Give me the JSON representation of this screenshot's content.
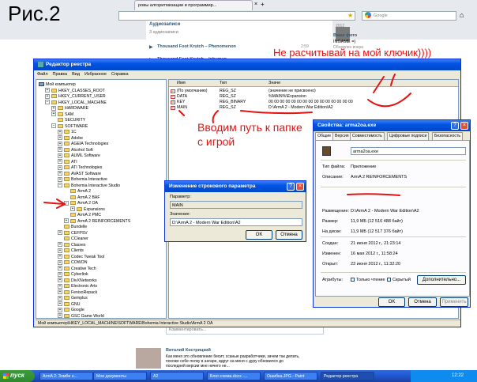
{
  "figure_label": "Рис.2",
  "browser": {
    "tabs": [
      "ровы алгоритмизации и программир..."
    ],
    "search_placeholder": "Google",
    "vk_title": "Аудиозаписи",
    "vk_subtitle": "3 аудиозаписи",
    "tracks": [
      {
        "title": "Thousand Foot Krutch – Phenomenon",
        "time": "2:59"
      },
      {
        "title": "Thousand Foot Krutch – Inhuman"
      }
    ],
    "right_year": "2012",
    "right_title": "Ваше фото",
    "right_sub1": "INGAME =)",
    "right_sub2": "Обновлен вчера",
    "comment_placeholder": "Комментировать...",
    "commenter_name": "Виталий Кострицкий",
    "comment_text": "Как меня это обновление бесит, ссаные разработчики, зачем так делать, похоже себе полку в ангаре, вдруг на меня с дуру обновился до последней версии мне ничего не..."
  },
  "regedit": {
    "title": "Редактор реестра",
    "menu": [
      "Файл",
      "Правка",
      "Вид",
      "Избранное",
      "Справка"
    ],
    "tree": [
      {
        "label": "Мой компьютер",
        "depth": 0,
        "expand": "-"
      },
      {
        "label": "HKEY_CLASSES_ROOT",
        "depth": 1,
        "expand": "+"
      },
      {
        "label": "HKEY_CURRENT_USER",
        "depth": 1,
        "expand": "+"
      },
      {
        "label": "HKEY_LOCAL_MACHINE",
        "depth": 1,
        "expand": "-"
      },
      {
        "label": "HARDWARE",
        "depth": 2,
        "expand": "+"
      },
      {
        "label": "SAM",
        "depth": 2,
        "expand": "+"
      },
      {
        "label": "SECURITY",
        "depth": 2,
        "expand": ""
      },
      {
        "label": "SOFTWARE",
        "depth": 2,
        "expand": "-"
      },
      {
        "label": "1C",
        "depth": 3,
        "expand": "+"
      },
      {
        "label": "Adobe",
        "depth": 3,
        "expand": "+"
      },
      {
        "label": "AGEIA Technologies",
        "depth": 3,
        "expand": "+"
      },
      {
        "label": "Alcohol Soft",
        "depth": 3,
        "expand": "+"
      },
      {
        "label": "ALWIL Software",
        "depth": 3,
        "expand": "+"
      },
      {
        "label": "ATI",
        "depth": 3,
        "expand": "+"
      },
      {
        "label": "ATI Technologies",
        "depth": 3,
        "expand": "+"
      },
      {
        "label": "AVAST Software",
        "depth": 3,
        "expand": "+"
      },
      {
        "label": "Bohemia Interactive",
        "depth": 3,
        "expand": "+"
      },
      {
        "label": "Bohemia Interactive Studio",
        "depth": 3,
        "expand": "-"
      },
      {
        "label": "ArmA 2",
        "depth": 4,
        "expand": ""
      },
      {
        "label": "ArmA 2 BAF",
        "depth": 4,
        "expand": ""
      },
      {
        "label": "ArmA 2 OA",
        "depth": 4,
        "expand": "-"
      },
      {
        "label": "Expansions",
        "depth": 5,
        "expand": "+"
      },
      {
        "label": "ArmA 2 PMC",
        "depth": 4,
        "expand": ""
      },
      {
        "label": "ArmA 2 REINFORCEMENTS",
        "depth": 4,
        "expand": "+"
      },
      {
        "label": "Bundelle",
        "depth": 3,
        "expand": ""
      },
      {
        "label": "CEFPSV",
        "depth": 3,
        "expand": "+"
      },
      {
        "label": "CCleaner",
        "depth": 3,
        "expand": ""
      },
      {
        "label": "Classes",
        "depth": 3,
        "expand": "+"
      },
      {
        "label": "Clients",
        "depth": 3,
        "expand": "+"
      },
      {
        "label": "Codec Tweak Tool",
        "depth": 3,
        "expand": "+"
      },
      {
        "label": "COWON",
        "depth": 3,
        "expand": "+"
      },
      {
        "label": "Creative Tech",
        "depth": 3,
        "expand": "+"
      },
      {
        "label": "Cyberlink",
        "depth": 3,
        "expand": "+"
      },
      {
        "label": "DivXNetworks",
        "depth": 3,
        "expand": "+"
      },
      {
        "label": "Electronic Arts",
        "depth": 3,
        "expand": "+"
      },
      {
        "label": "FenixoRepack",
        "depth": 3,
        "expand": "+"
      },
      {
        "label": "Gemplus",
        "depth": 3,
        "expand": "+"
      },
      {
        "label": "GNU",
        "depth": 3,
        "expand": "+"
      },
      {
        "label": "Google",
        "depth": 3,
        "expand": "+"
      },
      {
        "label": "GSC Game World",
        "depth": 3,
        "expand": "+"
      }
    ],
    "columns": {
      "name": "Имя",
      "type": "Тип",
      "value": "Значе"
    },
    "values": [
      {
        "name": "(По умолчанию)",
        "type": "REG_SZ",
        "data": "(значение не присвоено)"
      },
      {
        "name": "DATA",
        "type": "REG_SZ",
        "data": "%MAIN%\\Expansion"
      },
      {
        "name": "KEY",
        "type": "REG_BINARY",
        "data": "00 00 00 00 00 00 00 00 00 00 00 00 00 00 00"
      },
      {
        "name": "MAIN",
        "type": "REG_SZ",
        "data": "D:\\ArmA 2 - Modern War Edition\\A2"
      }
    ],
    "status": "Мой компьютер\\HKEY_LOCAL_MACHINE\\SOFTWARE\\Bohemia Interactive Studio\\ArmA 2 OA"
  },
  "edit_dialog": {
    "title": "Изменение строкового параметра",
    "param_label": "Параметр:",
    "param_value": "MAIN",
    "value_label": "Значение:",
    "value_value": "D:\\ArmA 2 - Modern War Edition\\A2",
    "ok": "OK",
    "cancel": "Отмена"
  },
  "properties_dialog": {
    "title": "Свойства: arma2oa.exe",
    "tabs": [
      "Общие",
      "Версия",
      "Совместимость",
      "Цифровые подписи",
      "Безопасность"
    ],
    "filename": "arma2oa.exe",
    "rows": [
      {
        "label": "Тип файла:",
        "value": "Приложение"
      },
      {
        "label": "Описание:",
        "value": "ArmA 2 REINFORCEMENTS"
      },
      {
        "label": "Размещение:",
        "value": "D:\\ArmA 2 - Modern War Edition\\A2"
      },
      {
        "label": "Размер:",
        "value": "11,9 МБ (12 516 488 байт)"
      },
      {
        "label": "На диске:",
        "value": "11,9 МБ (12 517 376 байт)"
      },
      {
        "label": "Создан:",
        "value": "21 июня 2012 г., 21:23:14"
      },
      {
        "label": "Изменен:",
        "value": "16 мая 2012 г., 11:58:24"
      },
      {
        "label": "Открыт:",
        "value": "23 июня 2012 г., 11:32:20"
      }
    ],
    "attrs_label": "Атрибуты:",
    "readonly": "Только чтение",
    "hidden": "Скрытый",
    "more": "Дополнительно...",
    "ok": "OK",
    "cancel": "Отмена",
    "apply": "Применить"
  },
  "annotations": {
    "no_key": "Не расчитывай на мой ключик))))",
    "enter_path": "Вводим путь к папке с игрой"
  },
  "taskbar": {
    "start": "пуск",
    "tasks": [
      "ArmA 2: Зомби н...",
      "Мои документы",
      "A2",
      "Блог-схема.docx -...",
      "Ошибка.JPG - Paint",
      "Редактор реестра"
    ],
    "time": "12:22"
  },
  "colors": {
    "annotation": "#e31313",
    "xp_title": "#0054e3",
    "taskbar": "#245edb",
    "start": "#3c9a3c"
  }
}
